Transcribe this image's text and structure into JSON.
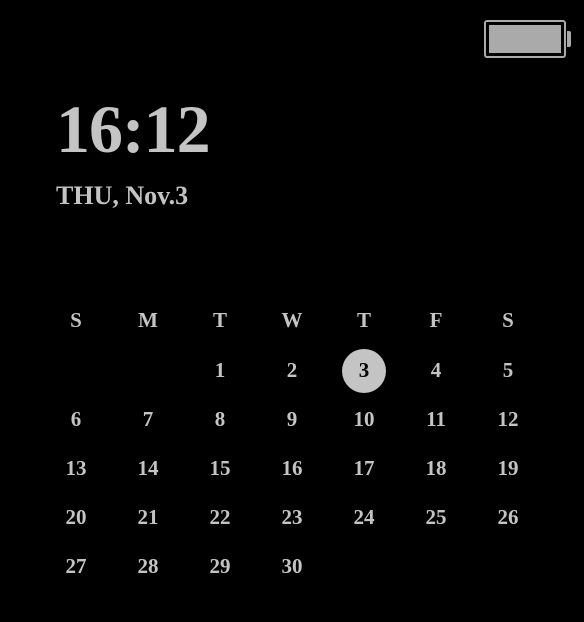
{
  "status": {
    "battery_level": 100
  },
  "clock": {
    "time": "16:12",
    "date": "THU, Nov.3"
  },
  "calendar": {
    "headers": [
      "S",
      "M",
      "T",
      "W",
      "T",
      "F",
      "S"
    ],
    "today": 3,
    "weeks": [
      [
        "",
        "",
        "1",
        "2",
        "3",
        "4",
        "5"
      ],
      [
        "6",
        "7",
        "8",
        "9",
        "10",
        "11",
        "12"
      ],
      [
        "13",
        "14",
        "15",
        "16",
        "17",
        "18",
        "19"
      ],
      [
        "20",
        "21",
        "22",
        "23",
        "24",
        "25",
        "26"
      ],
      [
        "27",
        "28",
        "29",
        "30",
        "",
        "",
        ""
      ]
    ]
  }
}
